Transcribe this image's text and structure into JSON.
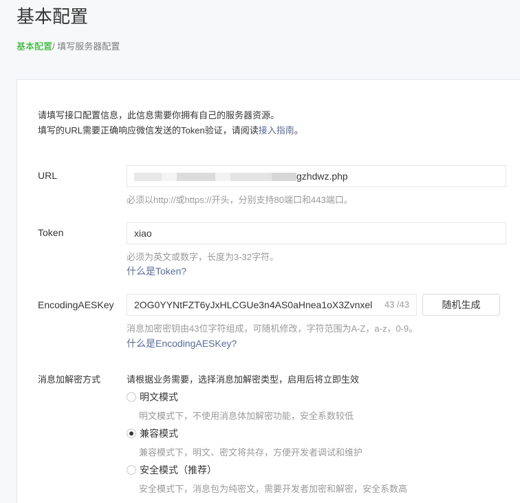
{
  "header": {
    "title": "基本配置",
    "breadcrumb_root": "基本配置",
    "breadcrumb_sep": "/",
    "breadcrumb_current": " 填写服务器配置"
  },
  "intro": {
    "line1": "请填写接口配置信息，此信息需要你拥有自己的服务器资源。",
    "line2_prefix": "填写的URL需要正确响应微信发送的Token验证，请阅读",
    "line2_link": "接入指南",
    "line2_suffix": "。"
  },
  "url": {
    "label": "URL",
    "value_visible": "gzhdwz.php",
    "hint": "必须以http://或https://开头，分别支持80端口和443端口。"
  },
  "token": {
    "label": "Token",
    "value": "xiao",
    "hint": "必须为英文或数字，长度为3-32字符。",
    "help_link": "什么是Token?"
  },
  "aes": {
    "label": "EncodingAESKey",
    "value": "2OG0YYNtFZT6yJxHLCGUe3n4AS0aHnea1oX3Zvnxel",
    "counter": "43 /43",
    "random_button": "随机生成",
    "hint": "消息加密密钥由43位字符组成，可随机修改，字符范围为A-Z，a-z，0-9。",
    "help_link": "什么是EncodingAESKey?"
  },
  "encryption": {
    "label": "消息加解密方式",
    "intro": "请根据业务需要，选择消息加解密类型，启用后将立即生效",
    "options": [
      {
        "label": "明文模式",
        "hint": "明文模式下，不使用消息体加解密功能，安全系数较低",
        "checked": false
      },
      {
        "label": "兼容模式",
        "hint": "兼容模式下，明文、密文将共存，方便开发者调试和维护",
        "checked": true
      },
      {
        "label": "安全模式（推荐）",
        "hint": "安全模式下，消息包为纯密文，需要开发者加密和解密，安全系数高",
        "checked": false
      }
    ]
  }
}
